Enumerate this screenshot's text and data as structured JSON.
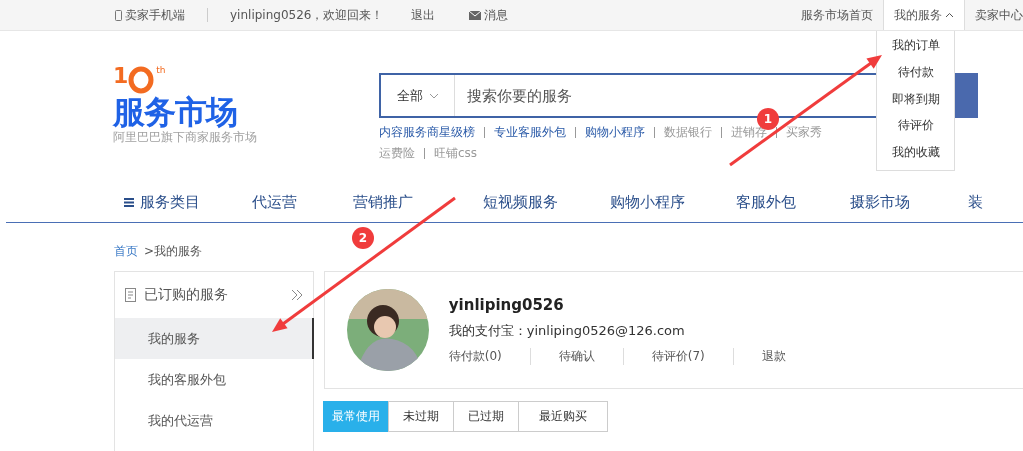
{
  "top_bar": {
    "left": [
      {
        "kind": "phone",
        "label": "卖家手机端"
      },
      {
        "kind": "plain",
        "label": "yinliping0526，欢迎回来！"
      },
      {
        "kind": "plain",
        "label": "退出"
      },
      {
        "kind": "mail",
        "label": "消息"
      }
    ],
    "right": [
      {
        "label": "服务市场首页",
        "expanded": false
      },
      {
        "label": "我的服务",
        "expanded": true
      },
      {
        "label": "卖家中心"
      }
    ]
  },
  "dropdown": {
    "items": [
      "我的订单",
      "待付款",
      "即将到期",
      "待评价",
      "我的收藏"
    ]
  },
  "logo": {
    "number": "1",
    "suffix": "th",
    "name": "服务市场",
    "tagline": "阿里巴巴旗下商家服务市场"
  },
  "search": {
    "scope": "全部",
    "placeholder": "搜索你要的服务"
  },
  "quick_links": [
    {
      "label": "内容服务商星级榜",
      "highlighted": true
    },
    {
      "label": "专业客服外包",
      "highlighted": true
    },
    {
      "label": "购物小程序",
      "highlighted": true
    },
    {
      "label": "数据银行",
      "highlighted": false
    },
    {
      "label": "进销存",
      "highlighted": false
    },
    {
      "label": "买家秀",
      "highlighted": false
    },
    {
      "label": "运费险",
      "highlighted": false
    },
    {
      "label": "旺铺css",
      "highlighted": false
    }
  ],
  "nav": [
    "服务类目",
    "代运营",
    "营销推广",
    "短视频服务",
    "购物小程序",
    "客服外包",
    "摄影市场",
    "装"
  ],
  "breadcrumb": [
    {
      "label": "首页",
      "kind": "link"
    },
    {
      "label": ">我的服务",
      "kind": "current"
    }
  ],
  "sidebar": {
    "title": "已订购的服务",
    "items": [
      {
        "label": "我的服务",
        "selected": true
      },
      {
        "label": "我的客服外包",
        "selected": false
      },
      {
        "label": "我的代运营",
        "selected": false
      }
    ]
  },
  "profile": {
    "username": "yinliping0526",
    "alipay": "我的支付宝：yinliping0526@126.com",
    "stats": [
      "待付款(0)",
      "待确认",
      "待评价(7)",
      "退款"
    ]
  },
  "tabs": [
    {
      "label": "最常使用",
      "selected": true
    },
    {
      "label": "未过期",
      "selected": false
    },
    {
      "label": "已过期",
      "selected": false
    },
    {
      "label": "最近购买",
      "selected": false
    }
  ],
  "annotations": [
    {
      "number": "1"
    },
    {
      "number": "2"
    }
  ]
}
